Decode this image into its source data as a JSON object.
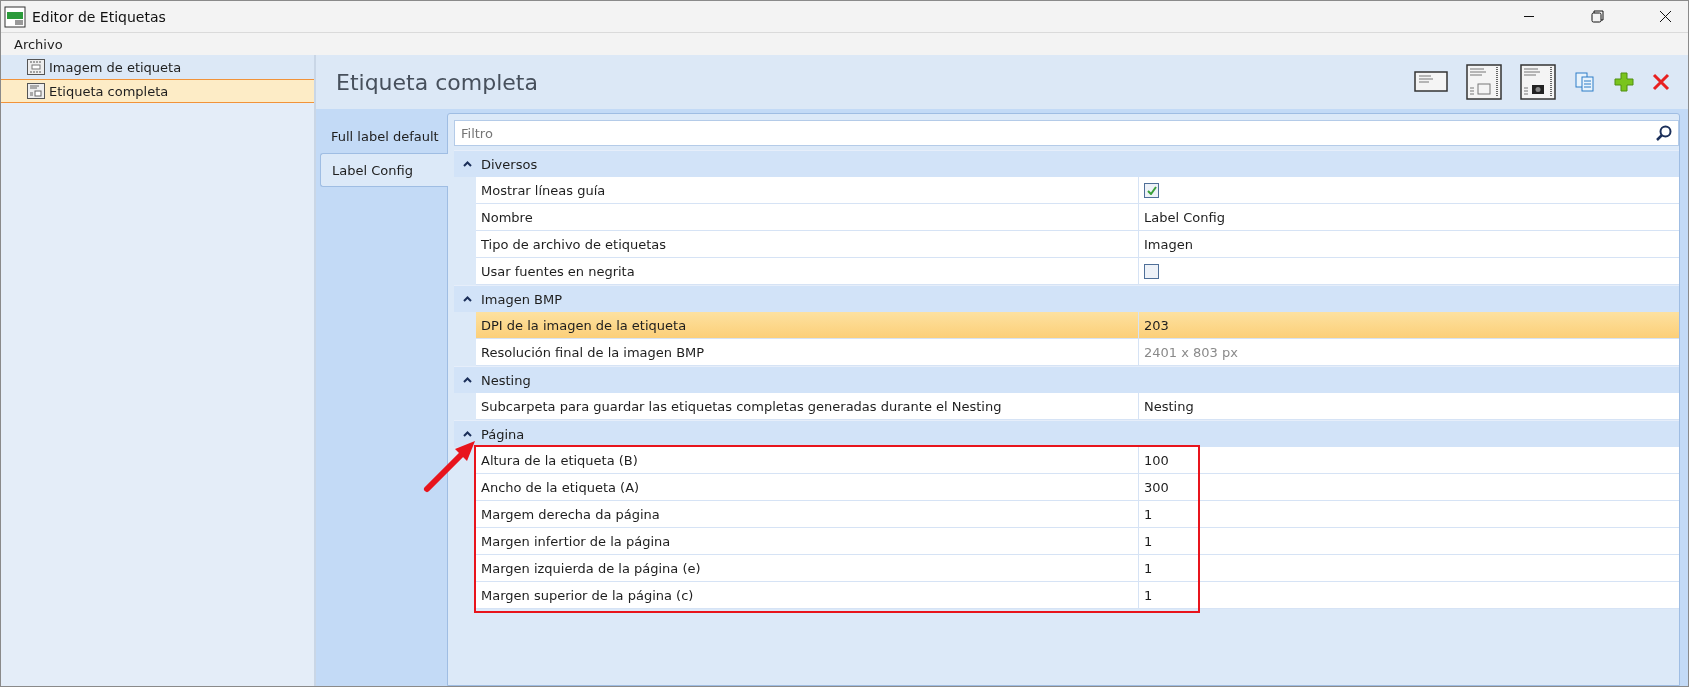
{
  "window": {
    "title": "Editor de Etiquetas"
  },
  "menu": [
    "Archivo"
  ],
  "sidebar": {
    "items": [
      {
        "label": "Imagem de etiqueta",
        "selected": false,
        "kind": "image"
      },
      {
        "label": "Etiqueta completa",
        "selected": true,
        "kind": "full"
      }
    ]
  },
  "header": {
    "title": "Etiqueta completa"
  },
  "tabs": [
    {
      "label": "Full label default",
      "selected": false
    },
    {
      "label": "Label Config",
      "selected": true
    }
  ],
  "filter": {
    "placeholder": "Filtro"
  },
  "groups": [
    {
      "name": "Diversos",
      "expanded": true,
      "highlighted": false,
      "rows": [
        {
          "label": "Mostrar líneas guía",
          "kind": "checkbox",
          "checked": true,
          "selected": false,
          "disabled": false
        },
        {
          "label": "Nombre",
          "kind": "text",
          "value": "Label Config",
          "selected": false,
          "disabled": false
        },
        {
          "label": "Tipo de archivo de etiquetas",
          "kind": "text",
          "value": "Imagen",
          "selected": false,
          "disabled": false
        },
        {
          "label": "Usar fuentes en negrita",
          "kind": "checkbox",
          "checked": false,
          "selected": false,
          "disabled": false
        }
      ]
    },
    {
      "name": "Imagen BMP",
      "expanded": true,
      "highlighted": false,
      "rows": [
        {
          "label": "DPI de la imagen de la etiqueta",
          "kind": "text",
          "value": "203",
          "selected": true,
          "disabled": false
        },
        {
          "label": "Resolución final de la imagen BMP",
          "kind": "text",
          "value": "2401 x 803 px",
          "selected": false,
          "disabled": true
        }
      ]
    },
    {
      "name": "Nesting",
      "expanded": true,
      "highlighted": false,
      "rows": [
        {
          "label": "Subcarpeta para guardar las etiquetas completas generadas durante el Nesting",
          "kind": "text",
          "value": "Nesting",
          "selected": false,
          "disabled": false
        }
      ]
    },
    {
      "name": "Página",
      "expanded": true,
      "highlighted": true,
      "rows": [
        {
          "label": "Altura de la etiqueta (B)",
          "kind": "text",
          "value": "100",
          "selected": false,
          "disabled": false
        },
        {
          "label": "Ancho de la etiqueta (A)",
          "kind": "text",
          "value": "300",
          "selected": false,
          "disabled": false
        },
        {
          "label": "Margem derecha da página",
          "kind": "text",
          "value": "1",
          "selected": false,
          "disabled": false
        },
        {
          "label": "Margen infertior de la página",
          "kind": "text",
          "value": "1",
          "selected": false,
          "disabled": false
        },
        {
          "label": "Margen izquierda de la página (e)",
          "kind": "text",
          "value": "1",
          "selected": false,
          "disabled": false
        },
        {
          "label": "Margen superior de la página (c)",
          "kind": "text",
          "value": "1",
          "selected": false,
          "disabled": false
        }
      ]
    }
  ]
}
